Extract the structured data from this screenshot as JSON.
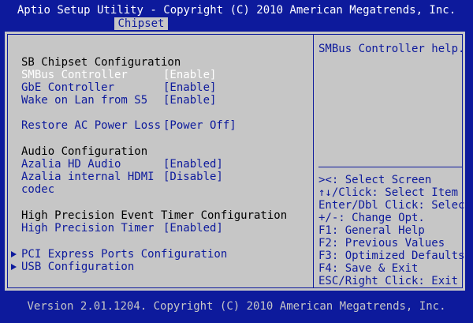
{
  "header": {
    "title": "Aptio Setup Utility - Copyright (C) 2010 American Megatrends, Inc.",
    "tab": "Chipset"
  },
  "main": {
    "section_sb": "SB Chipset Configuration",
    "items": [
      {
        "label": "SMBus Controller",
        "value": "[Enable]"
      },
      {
        "label": "GbE Controller",
        "value": "[Enable]"
      },
      {
        "label": "Wake on Lan from S5",
        "value": "[Enable]"
      },
      {
        "label": "Restore AC Power Loss",
        "value": "[Power Off]"
      },
      {
        "label": "Azalia HD Audio",
        "value": "[Enabled]"
      },
      {
        "label": "Azalia internal HDMI",
        "label2": "codec",
        "value": "[Disable]"
      },
      {
        "label": "High Precision Timer",
        "value": "[Enabled]"
      }
    ],
    "section_audio": "Audio Configuration",
    "section_hpet": "High Precision Event Timer Configuration",
    "submenus": [
      {
        "label": "PCI Express Ports Configuration"
      },
      {
        "label": "USB Configuration"
      }
    ]
  },
  "help": {
    "text": "SMBus Controller help.",
    "keys": [
      "><: Select Screen",
      "↑↓/Click: Select Item",
      "Enter/Dbl Click: Select",
      "+/-: Change Opt.",
      "F1: General Help",
      "F2: Previous Values",
      "F3: Optimized Defaults",
      "F4: Save & Exit",
      "ESC/Right Click: Exit"
    ]
  },
  "footer": {
    "text": "Version 2.01.1204. Copyright (C) 2010 American Megatrends, Inc."
  },
  "colors": {
    "background": "#0d1a9c",
    "panel": "#c6c6c6",
    "text": "#0d1a9c",
    "heading": "#000000",
    "selected": "#ffffff"
  }
}
